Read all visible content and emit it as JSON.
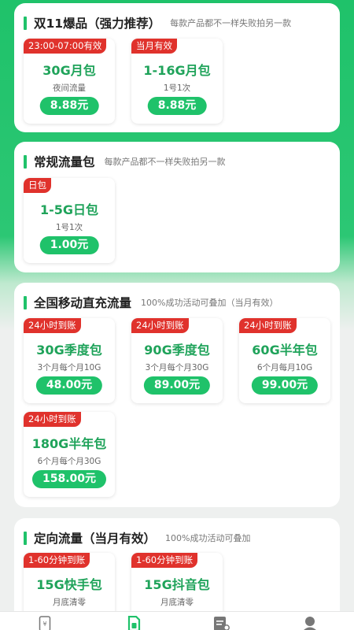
{
  "sections": [
    {
      "title": "双11爆品（强力推荐）",
      "subtitle": "每款产品都不一样失败拍另一款",
      "cards": [
        {
          "badge": "23:00-07:00有效",
          "title": "30G月包",
          "desc": "夜间流量",
          "price": "8.88元"
        },
        {
          "badge": "当月有效",
          "title": "1-16G月包",
          "desc": "1号1次",
          "price": "8.88元"
        }
      ]
    },
    {
      "title": "常规流量包",
      "subtitle": "每款产品都不一样失败拍另一款",
      "cards": [
        {
          "badge": "日包",
          "title": "1-5G日包",
          "desc": "1号1次",
          "price": "1.00元"
        }
      ]
    },
    {
      "title": "全国移动直充流量",
      "subtitle": "100%成功活动可叠加（当月有效）",
      "cards": [
        {
          "badge": "24小时到账",
          "title": "30G季度包",
          "desc": "3个月每个月10G",
          "price": "48.00元"
        },
        {
          "badge": "24小时到账",
          "title": "90G季度包",
          "desc": "3个月每个月30G",
          "price": "89.00元"
        },
        {
          "badge": "24小时到账",
          "title": "60G半年包",
          "desc": "6个月每月10G",
          "price": "99.00元"
        },
        {
          "badge": "24小时到账",
          "title": "180G半年包",
          "desc": "6个月每个月30G",
          "price": "158.00元"
        }
      ]
    },
    {
      "title": "定向流量（当月有效）",
      "subtitle": "100%成功活动可叠加",
      "cards": [
        {
          "badge": "1-60分钟到账",
          "title": "15G快手包",
          "desc": "月底清零"
        },
        {
          "badge": "1-60分钟到账",
          "title": "15G抖音包",
          "desc": "月底清零"
        }
      ]
    }
  ],
  "tabbar": {
    "items": [
      {
        "icon": "phone-recharge-icon"
      },
      {
        "icon": "sim-card-icon",
        "active": true
      },
      {
        "icon": "orders-icon"
      },
      {
        "icon": "profile-icon"
      }
    ]
  },
  "colors": {
    "brand_green": "#1fc26a",
    "badge_red": "#e0322c",
    "title_green": "#1fa35a"
  }
}
